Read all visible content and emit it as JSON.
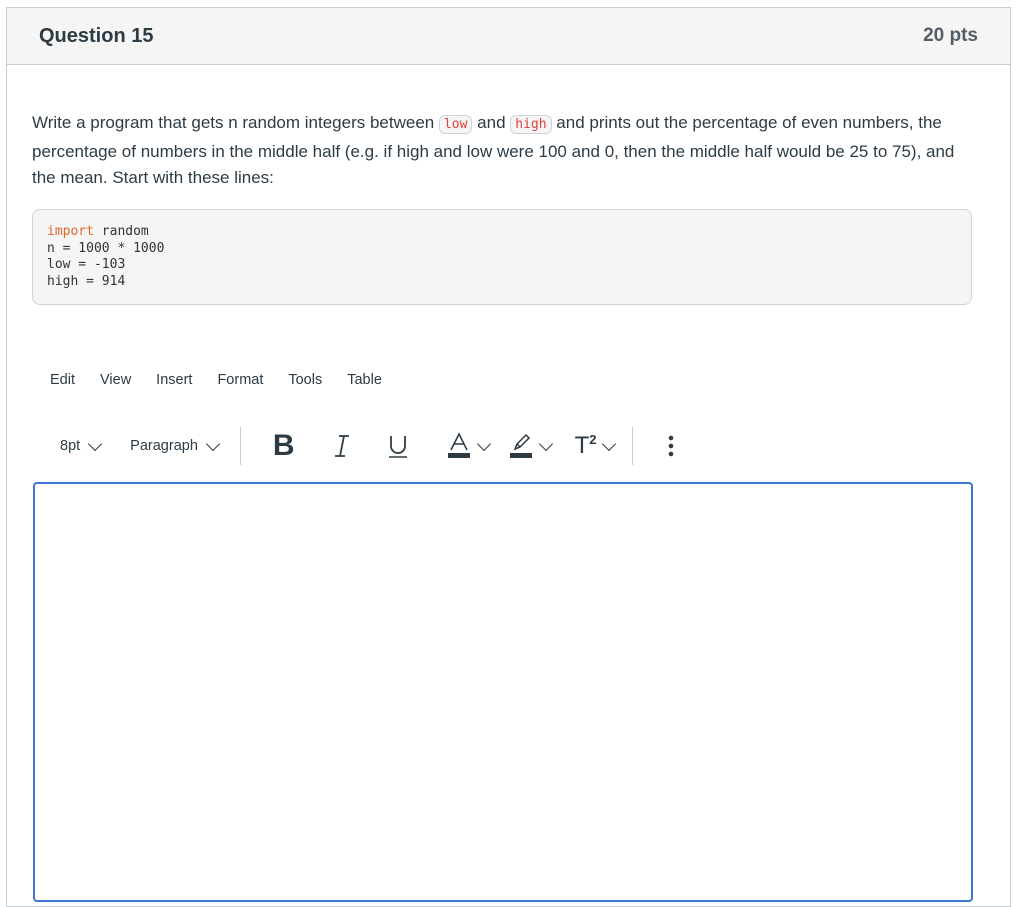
{
  "question": {
    "title": "Question 15",
    "points": "20 pts",
    "text": {
      "part1": "Write a program that gets n random integers between ",
      "code_low": "low",
      "part2": " and ",
      "code_high": "high",
      "part3": " and prints out the percentage of even numbers, the percentage of numbers in the middle half (e.g. if high and low were 100 and 0, then the middle half would be 25 to 75), and the mean. Start with these lines:"
    },
    "code_block": {
      "lines": [
        {
          "keyword": "import",
          "rest": " random"
        },
        {
          "keyword": "",
          "rest": "n = 1000 * 1000"
        },
        {
          "keyword": "",
          "rest": "low = -103"
        },
        {
          "keyword": "",
          "rest": "high = 914"
        }
      ]
    }
  },
  "editor": {
    "menu": [
      "Edit",
      "View",
      "Insert",
      "Format",
      "Tools",
      "Table"
    ],
    "toolbar": {
      "font_size": "8pt",
      "block_format": "Paragraph",
      "bold_icon": "B",
      "italic_icon": "I",
      "underline_icon": "U",
      "text_color_icon": "A",
      "superscript_icon": "T",
      "superscript_mark": "2",
      "more_icon": "⋮"
    },
    "content": ""
  },
  "colors": {
    "accent": "#3a78d4",
    "code_inline": "#e0403a",
    "code_keyword": "#e0662a"
  }
}
